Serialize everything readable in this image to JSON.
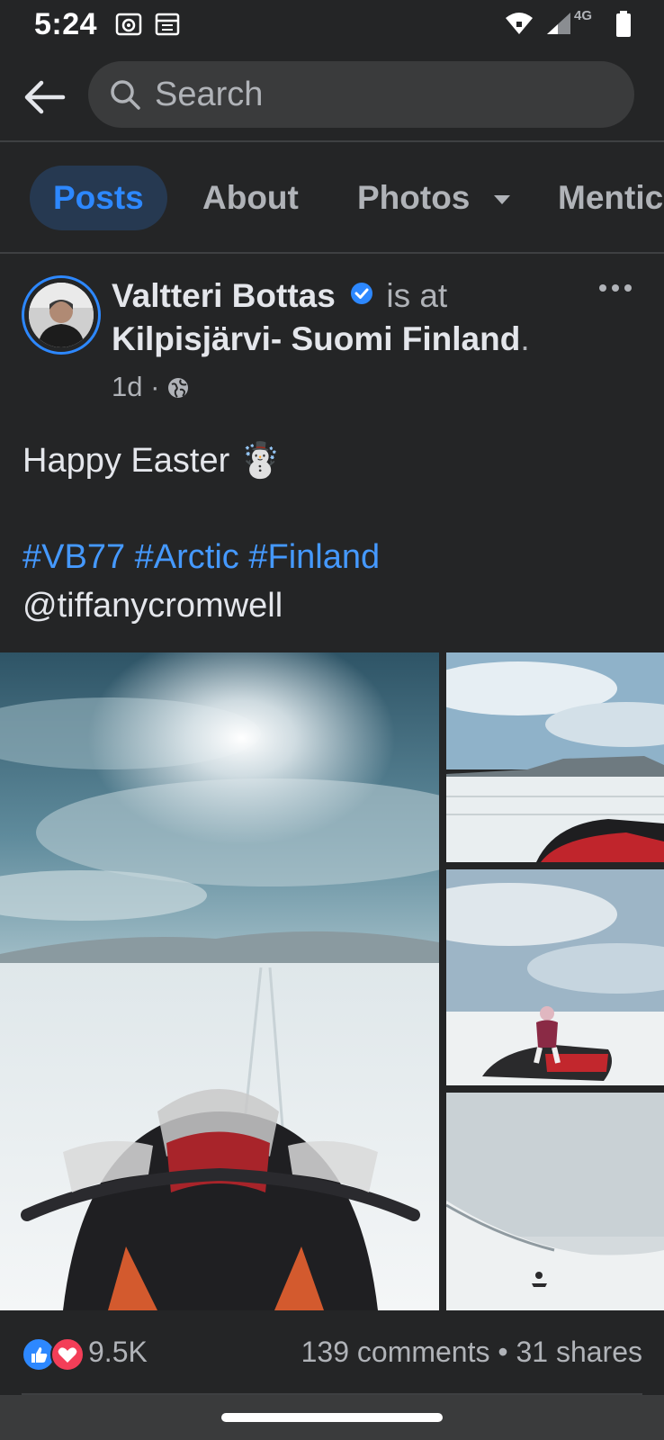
{
  "status": {
    "time": "5:24",
    "network": "4G",
    "battery_level": "60"
  },
  "search": {
    "placeholder": "Search"
  },
  "tabs": [
    {
      "label": "Posts",
      "active": true
    },
    {
      "label": "About",
      "active": false
    },
    {
      "label": "Photos",
      "active": false
    },
    {
      "label": "Mentic",
      "active": false
    }
  ],
  "post": {
    "author": "Valtteri Bottas",
    "connector": "is at",
    "location": "Kilpisjärvi- Suomi Finland",
    "location_suffix": ".",
    "time": "1d",
    "meta_sep": "·",
    "text_line1": "Happy Easter ☃️",
    "hashtags": [
      "#VB77",
      "#Arctic",
      "#Finland"
    ],
    "mention": "@tiffanycromwell"
  },
  "reactions": {
    "count": "9.5K",
    "comments": "139 comments",
    "separator": "•",
    "shares": "31 shares",
    "types": [
      "like-icon",
      "love-icon"
    ]
  },
  "colors": {
    "background": "#242526",
    "accent": "#2d88ff",
    "hashtag": "#4599ff",
    "secondary_text": "#b0b3b8"
  }
}
